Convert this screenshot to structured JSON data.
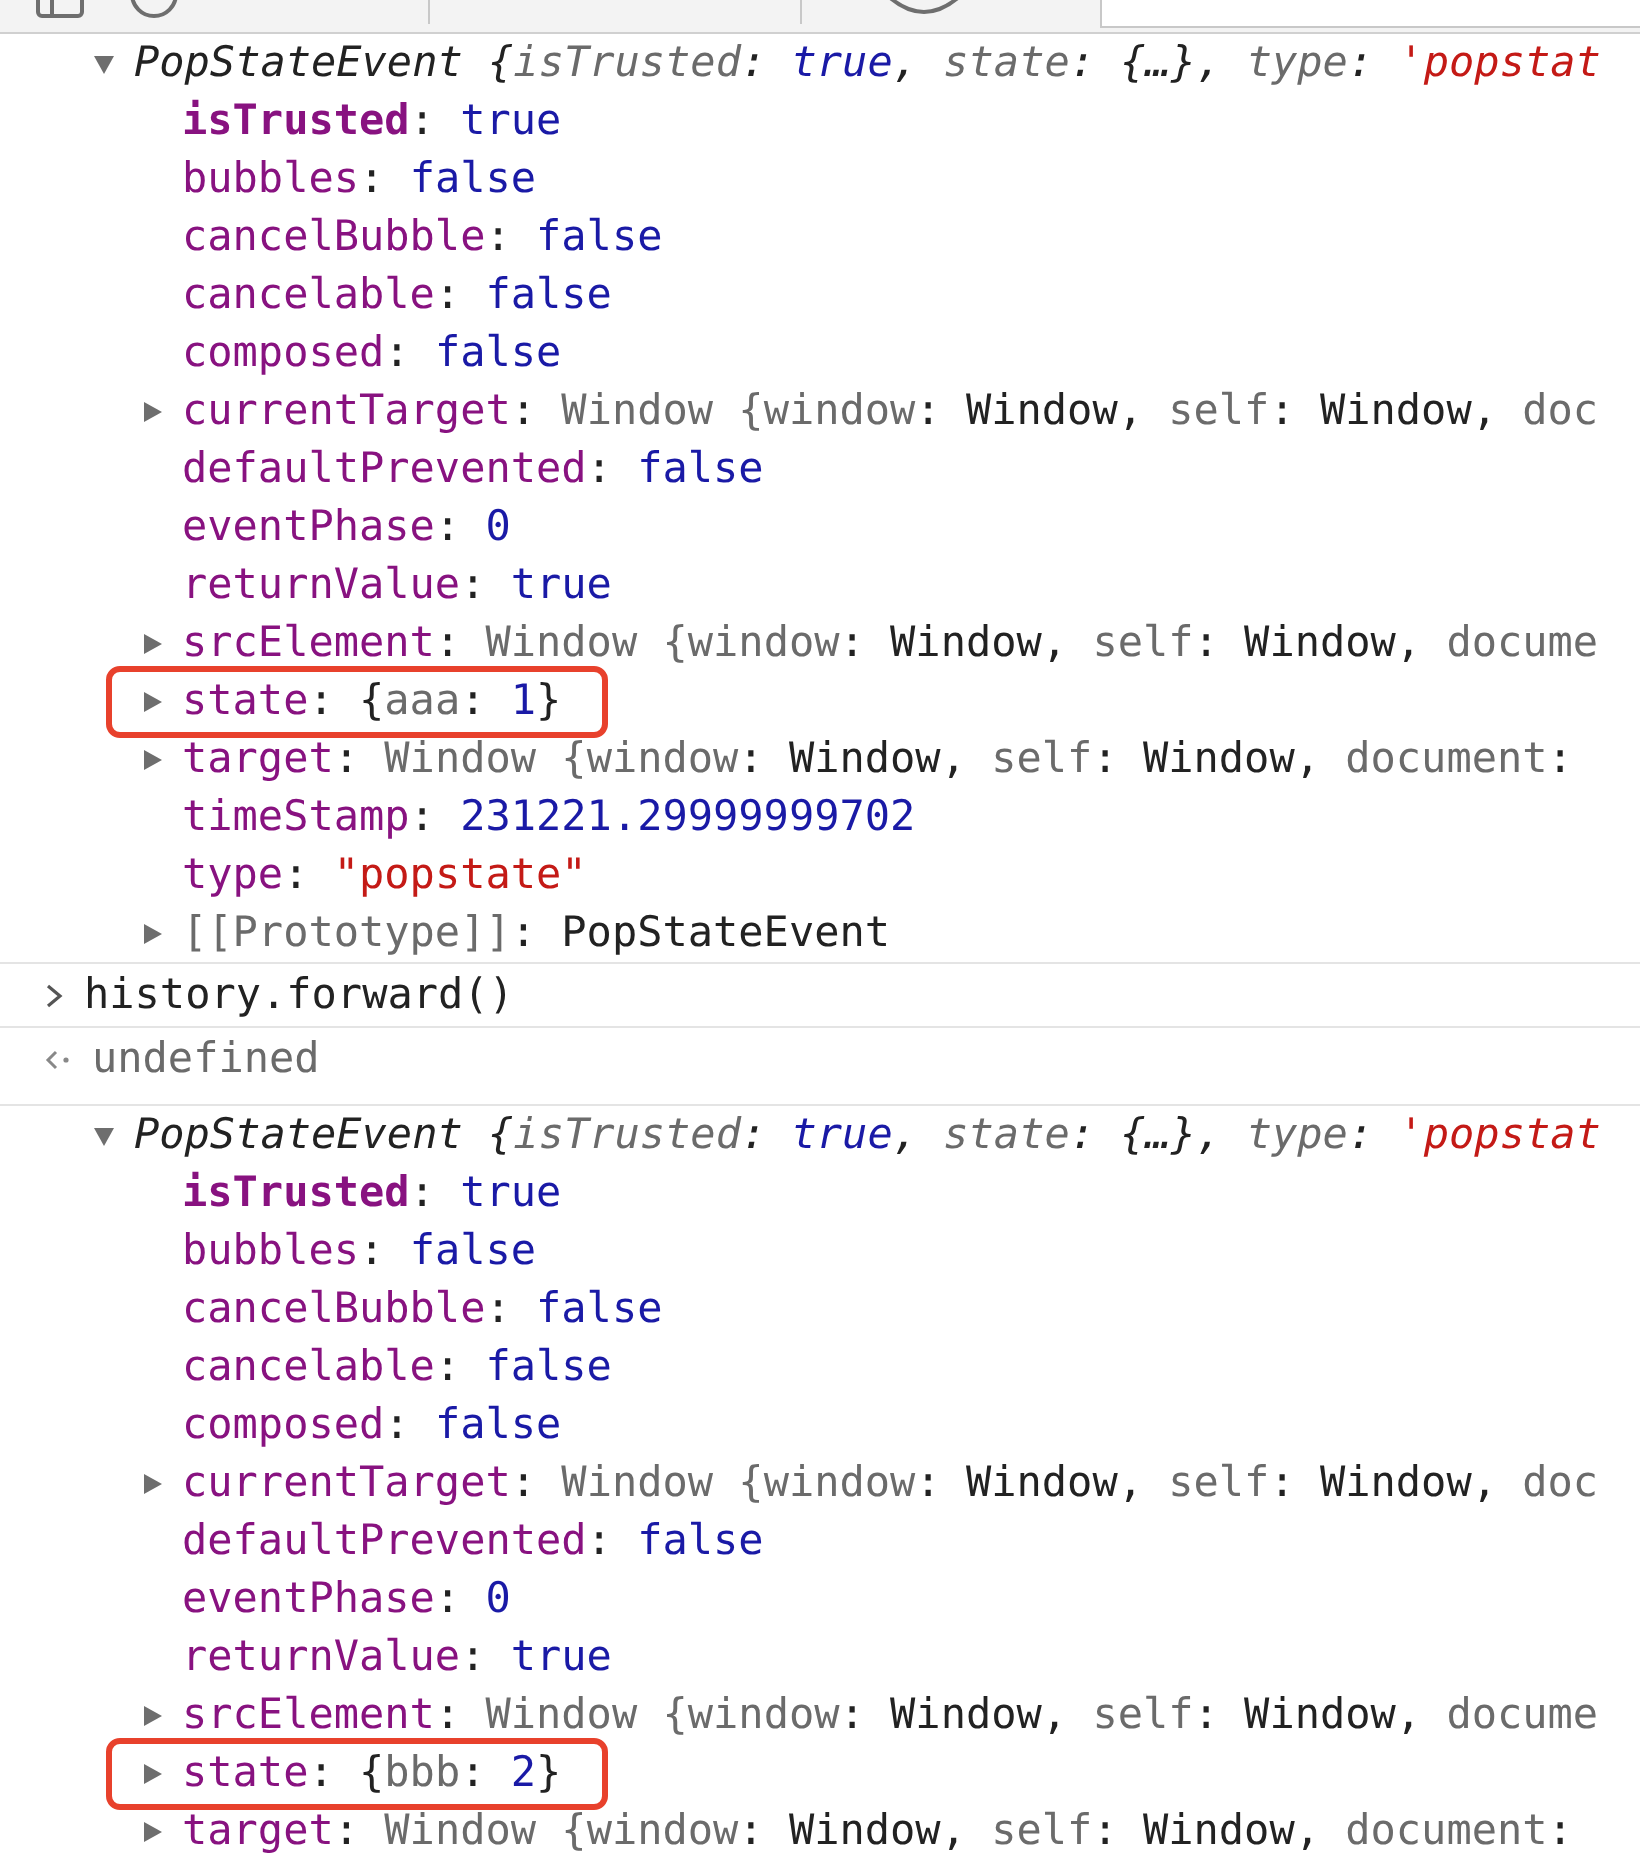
{
  "console": [
    {
      "kind": "header",
      "expandable": true,
      "expanded": true,
      "highlighted": false,
      "segments": [
        {
          "text": "PopStateEvent ",
          "kind": "cls"
        },
        {
          "text": "{",
          "kind": "plain"
        },
        {
          "text": "isTrusted",
          "kind": "dim"
        },
        {
          "text": ": ",
          "kind": "plain"
        },
        {
          "text": "true",
          "kind": "bool"
        },
        {
          "text": ", ",
          "kind": "plain"
        },
        {
          "text": "state",
          "kind": "dim"
        },
        {
          "text": ": {…}, ",
          "kind": "plain"
        },
        {
          "text": "type",
          "kind": "dim"
        },
        {
          "text": ": ",
          "kind": "plain"
        },
        {
          "text": "'popstat",
          "kind": "string"
        }
      ]
    },
    {
      "kind": "prop",
      "expandable": false,
      "highlighted": false,
      "segments": [
        {
          "text": "isTrusted",
          "kind": "ownkey"
        },
        {
          "text": ": ",
          "kind": "plain"
        },
        {
          "text": "true",
          "kind": "bool"
        }
      ]
    },
    {
      "kind": "prop",
      "expandable": false,
      "highlighted": false,
      "segments": [
        {
          "text": "bubbles",
          "kind": "key"
        },
        {
          "text": ": ",
          "kind": "plain"
        },
        {
          "text": "false",
          "kind": "bool"
        }
      ]
    },
    {
      "kind": "prop",
      "expandable": false,
      "highlighted": false,
      "segments": [
        {
          "text": "cancelBubble",
          "kind": "key"
        },
        {
          "text": ": ",
          "kind": "plain"
        },
        {
          "text": "false",
          "kind": "bool"
        }
      ]
    },
    {
      "kind": "prop",
      "expandable": false,
      "highlighted": false,
      "segments": [
        {
          "text": "cancelable",
          "kind": "key"
        },
        {
          "text": ": ",
          "kind": "plain"
        },
        {
          "text": "false",
          "kind": "bool"
        }
      ]
    },
    {
      "kind": "prop",
      "expandable": false,
      "highlighted": false,
      "segments": [
        {
          "text": "composed",
          "kind": "key"
        },
        {
          "text": ": ",
          "kind": "plain"
        },
        {
          "text": "false",
          "kind": "bool"
        }
      ]
    },
    {
      "kind": "prop",
      "expandable": true,
      "expanded": false,
      "highlighted": false,
      "segments": [
        {
          "text": "currentTarget",
          "kind": "key"
        },
        {
          "text": ": ",
          "kind": "plain"
        },
        {
          "text": "Window {",
          "kind": "dim"
        },
        {
          "text": "window",
          "kind": "dim"
        },
        {
          "text": ": Window, ",
          "kind": "plain"
        },
        {
          "text": "self",
          "kind": "dim"
        },
        {
          "text": ": Window, ",
          "kind": "plain"
        },
        {
          "text": "doc",
          "kind": "dim"
        }
      ]
    },
    {
      "kind": "prop",
      "expandable": false,
      "highlighted": false,
      "segments": [
        {
          "text": "defaultPrevented",
          "kind": "key"
        },
        {
          "text": ": ",
          "kind": "plain"
        },
        {
          "text": "false",
          "kind": "bool"
        }
      ]
    },
    {
      "kind": "prop",
      "expandable": false,
      "highlighted": false,
      "segments": [
        {
          "text": "eventPhase",
          "kind": "key"
        },
        {
          "text": ": ",
          "kind": "plain"
        },
        {
          "text": "0",
          "kind": "bool"
        }
      ]
    },
    {
      "kind": "prop",
      "expandable": false,
      "highlighted": false,
      "segments": [
        {
          "text": "returnValue",
          "kind": "key"
        },
        {
          "text": ": ",
          "kind": "plain"
        },
        {
          "text": "true",
          "kind": "bool"
        }
      ]
    },
    {
      "kind": "prop",
      "expandable": true,
      "expanded": false,
      "highlighted": false,
      "segments": [
        {
          "text": "srcElement",
          "kind": "key"
        },
        {
          "text": ": ",
          "kind": "plain"
        },
        {
          "text": "Window {",
          "kind": "dim"
        },
        {
          "text": "window",
          "kind": "dim"
        },
        {
          "text": ": Window, ",
          "kind": "plain"
        },
        {
          "text": "self",
          "kind": "dim"
        },
        {
          "text": ": Window, ",
          "kind": "plain"
        },
        {
          "text": "docume",
          "kind": "dim"
        }
      ]
    },
    {
      "kind": "prop",
      "expandable": true,
      "expanded": false,
      "highlighted": true,
      "segments": [
        {
          "text": "state",
          "kind": "key"
        },
        {
          "text": ": {",
          "kind": "plain"
        },
        {
          "text": "aaa",
          "kind": "dim"
        },
        {
          "text": ": ",
          "kind": "plain"
        },
        {
          "text": "1",
          "kind": "bool"
        },
        {
          "text": "}",
          "kind": "plain"
        }
      ]
    },
    {
      "kind": "prop",
      "expandable": true,
      "expanded": false,
      "highlighted": false,
      "segments": [
        {
          "text": "target",
          "kind": "key"
        },
        {
          "text": ": ",
          "kind": "plain"
        },
        {
          "text": "Window {",
          "kind": "dim"
        },
        {
          "text": "window",
          "kind": "dim"
        },
        {
          "text": ": Window, ",
          "kind": "plain"
        },
        {
          "text": "self",
          "kind": "dim"
        },
        {
          "text": ": Window, ",
          "kind": "plain"
        },
        {
          "text": "document",
          "kind": "dim"
        },
        {
          "text": ": ",
          "kind": "plain"
        }
      ]
    },
    {
      "kind": "prop",
      "expandable": false,
      "highlighted": false,
      "segments": [
        {
          "text": "timeStamp",
          "kind": "key"
        },
        {
          "text": ": ",
          "kind": "plain"
        },
        {
          "text": "231221.29999999702",
          "kind": "bool"
        }
      ]
    },
    {
      "kind": "prop",
      "expandable": false,
      "highlighted": false,
      "segments": [
        {
          "text": "type",
          "kind": "key"
        },
        {
          "text": ": ",
          "kind": "plain"
        },
        {
          "text": "\"popstate\"",
          "kind": "string"
        }
      ]
    },
    {
      "kind": "prop",
      "expandable": true,
      "expanded": false,
      "highlighted": false,
      "segments": [
        {
          "text": "[[Prototype]]",
          "kind": "dim"
        },
        {
          "text": ": PopStateEvent",
          "kind": "plain"
        }
      ]
    },
    {
      "kind": "command",
      "segments": [
        {
          "text": "history.forward()",
          "kind": "plain"
        }
      ]
    },
    {
      "kind": "result",
      "segments": [
        {
          "text": "undefined",
          "kind": "dim"
        }
      ]
    },
    {
      "kind": "header",
      "expandable": true,
      "expanded": true,
      "highlighted": false,
      "segments": [
        {
          "text": "PopStateEvent ",
          "kind": "cls"
        },
        {
          "text": "{",
          "kind": "plain"
        },
        {
          "text": "isTrusted",
          "kind": "dim"
        },
        {
          "text": ": ",
          "kind": "plain"
        },
        {
          "text": "true",
          "kind": "bool"
        },
        {
          "text": ", ",
          "kind": "plain"
        },
        {
          "text": "state",
          "kind": "dim"
        },
        {
          "text": ": {…}, ",
          "kind": "plain"
        },
        {
          "text": "type",
          "kind": "dim"
        },
        {
          "text": ": ",
          "kind": "plain"
        },
        {
          "text": "'popstat",
          "kind": "string"
        }
      ]
    },
    {
      "kind": "prop",
      "expandable": false,
      "highlighted": false,
      "segments": [
        {
          "text": "isTrusted",
          "kind": "ownkey"
        },
        {
          "text": ": ",
          "kind": "plain"
        },
        {
          "text": "true",
          "kind": "bool"
        }
      ]
    },
    {
      "kind": "prop",
      "expandable": false,
      "highlighted": false,
      "segments": [
        {
          "text": "bubbles",
          "kind": "key"
        },
        {
          "text": ": ",
          "kind": "plain"
        },
        {
          "text": "false",
          "kind": "bool"
        }
      ]
    },
    {
      "kind": "prop",
      "expandable": false,
      "highlighted": false,
      "segments": [
        {
          "text": "cancelBubble",
          "kind": "key"
        },
        {
          "text": ": ",
          "kind": "plain"
        },
        {
          "text": "false",
          "kind": "bool"
        }
      ]
    },
    {
      "kind": "prop",
      "expandable": false,
      "highlighted": false,
      "segments": [
        {
          "text": "cancelable",
          "kind": "key"
        },
        {
          "text": ": ",
          "kind": "plain"
        },
        {
          "text": "false",
          "kind": "bool"
        }
      ]
    },
    {
      "kind": "prop",
      "expandable": false,
      "highlighted": false,
      "segments": [
        {
          "text": "composed",
          "kind": "key"
        },
        {
          "text": ": ",
          "kind": "plain"
        },
        {
          "text": "false",
          "kind": "bool"
        }
      ]
    },
    {
      "kind": "prop",
      "expandable": true,
      "expanded": false,
      "highlighted": false,
      "segments": [
        {
          "text": "currentTarget",
          "kind": "key"
        },
        {
          "text": ": ",
          "kind": "plain"
        },
        {
          "text": "Window {",
          "kind": "dim"
        },
        {
          "text": "window",
          "kind": "dim"
        },
        {
          "text": ": Window, ",
          "kind": "plain"
        },
        {
          "text": "self",
          "kind": "dim"
        },
        {
          "text": ": Window, ",
          "kind": "plain"
        },
        {
          "text": "doc",
          "kind": "dim"
        }
      ]
    },
    {
      "kind": "prop",
      "expandable": false,
      "highlighted": false,
      "segments": [
        {
          "text": "defaultPrevented",
          "kind": "key"
        },
        {
          "text": ": ",
          "kind": "plain"
        },
        {
          "text": "false",
          "kind": "bool"
        }
      ]
    },
    {
      "kind": "prop",
      "expandable": false,
      "highlighted": false,
      "segments": [
        {
          "text": "eventPhase",
          "kind": "key"
        },
        {
          "text": ": ",
          "kind": "plain"
        },
        {
          "text": "0",
          "kind": "bool"
        }
      ]
    },
    {
      "kind": "prop",
      "expandable": false,
      "highlighted": false,
      "segments": [
        {
          "text": "returnValue",
          "kind": "key"
        },
        {
          "text": ": ",
          "kind": "plain"
        },
        {
          "text": "true",
          "kind": "bool"
        }
      ]
    },
    {
      "kind": "prop",
      "expandable": true,
      "expanded": false,
      "highlighted": false,
      "segments": [
        {
          "text": "srcElement",
          "kind": "key"
        },
        {
          "text": ": ",
          "kind": "plain"
        },
        {
          "text": "Window {",
          "kind": "dim"
        },
        {
          "text": "window",
          "kind": "dim"
        },
        {
          "text": ": Window, ",
          "kind": "plain"
        },
        {
          "text": "self",
          "kind": "dim"
        },
        {
          "text": ": Window, ",
          "kind": "plain"
        },
        {
          "text": "docume",
          "kind": "dim"
        }
      ]
    },
    {
      "kind": "prop",
      "expandable": true,
      "expanded": false,
      "highlighted": true,
      "segments": [
        {
          "text": "state",
          "kind": "key"
        },
        {
          "text": ": {",
          "kind": "plain"
        },
        {
          "text": "bbb",
          "kind": "dim"
        },
        {
          "text": ": ",
          "kind": "plain"
        },
        {
          "text": "2",
          "kind": "bool"
        },
        {
          "text": "}",
          "kind": "plain"
        }
      ]
    },
    {
      "kind": "prop",
      "expandable": true,
      "expanded": false,
      "highlighted": false,
      "segments": [
        {
          "text": "target",
          "kind": "key"
        },
        {
          "text": ": ",
          "kind": "plain"
        },
        {
          "text": "Window {",
          "kind": "dim"
        },
        {
          "text": "window",
          "kind": "dim"
        },
        {
          "text": ": Window, ",
          "kind": "plain"
        },
        {
          "text": "self",
          "kind": "dim"
        },
        {
          "text": ": Window, ",
          "kind": "plain"
        },
        {
          "text": "document",
          "kind": "dim"
        },
        {
          "text": ": ",
          "kind": "plain"
        }
      ]
    }
  ]
}
